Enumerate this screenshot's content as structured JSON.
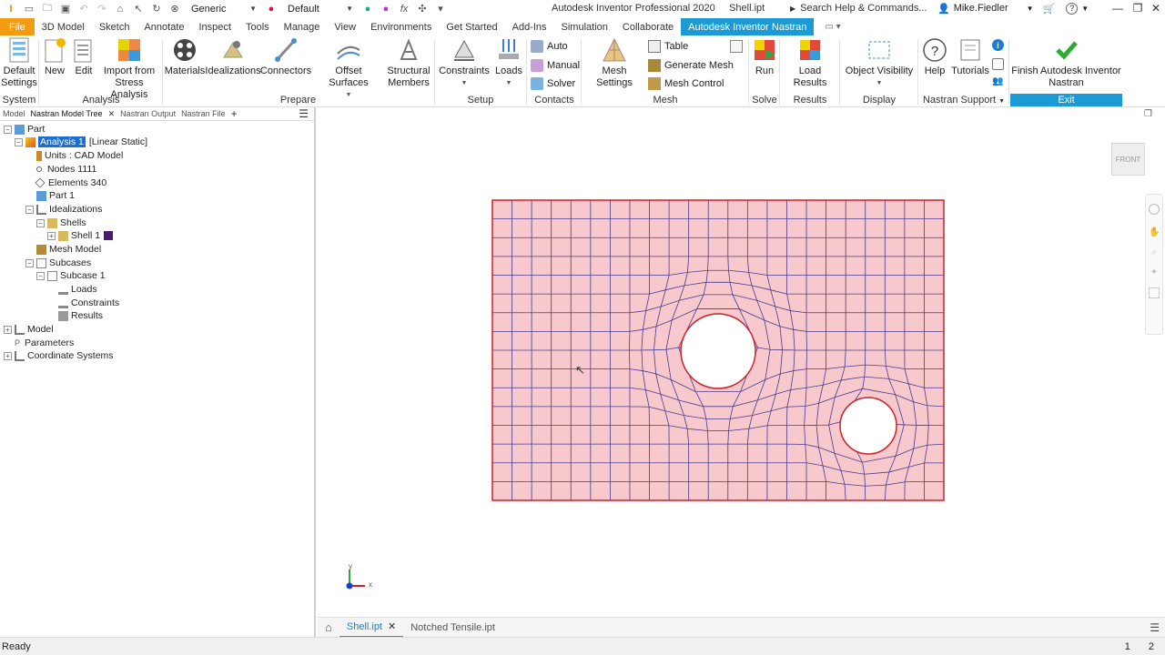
{
  "titlebar": {
    "app_title": "Autodesk Inventor Professional 2020",
    "doc_title": "Shell.ipt",
    "material_select": "Generic",
    "appearance_select": "Default",
    "search_placeholder": "Search Help & Commands...",
    "user_name": "Mike.Fiedler"
  },
  "ribbon_tabs": [
    "File",
    "3D Model",
    "Sketch",
    "Annotate",
    "Inspect",
    "Tools",
    "Manage",
    "View",
    "Environments",
    "Get Started",
    "Add-Ins",
    "Simulation",
    "Collaborate",
    "Autodesk Inventor Nastran"
  ],
  "ribbon": {
    "default_settings": "Default Settings",
    "new": "New",
    "edit": "Edit",
    "import_from_stress": "Import from Stress Analysis",
    "materials": "Materials",
    "idealizations": "Idealizations",
    "connectors": "Connectors",
    "offset_surfaces": "Offset Surfaces",
    "structural_members": "Structural Members",
    "constraints": "Constraints",
    "loads": "Loads",
    "auto": "Auto",
    "manual": "Manual",
    "solver": "Solver",
    "mesh_settings": "Mesh Settings",
    "table": "Table",
    "generate_mesh": "Generate Mesh",
    "mesh_control": "Mesh Control",
    "run": "Run",
    "load_results": "Load Results",
    "object_visibility": "Object Visibility",
    "help": "Help",
    "tutorials": "Tutorials",
    "finish": "Finish Autodesk Inventor Nastran",
    "groups": {
      "system": "System",
      "analysis": "Analysis",
      "prepare": "Prepare",
      "setup": "Setup",
      "contacts": "Contacts",
      "mesh": "Mesh",
      "solve": "Solve",
      "results": "Results",
      "display": "Display",
      "nastran_support": "Nastran Support",
      "exit": "Exit"
    }
  },
  "browser": {
    "tabs": [
      "Model",
      "Nastran Model Tree",
      "Nastran Output",
      "Nastran File"
    ],
    "tree": [
      {
        "label": "Part",
        "indent": 0
      },
      {
        "label": "Analysis 1",
        "suffix": "[Linear Static]",
        "indent": 1
      },
      {
        "label": "Units : CAD Model",
        "indent": 2
      },
      {
        "label": "Nodes 1111",
        "indent": 2
      },
      {
        "label": "Elements 340",
        "indent": 2
      },
      {
        "label": "Part 1",
        "indent": 2
      },
      {
        "label": "Idealizations",
        "indent": 2
      },
      {
        "label": "Shells",
        "indent": 3
      },
      {
        "label": "Shell 1",
        "indent": 4
      },
      {
        "label": "Mesh Model",
        "indent": 2
      },
      {
        "label": "Subcases",
        "indent": 2
      },
      {
        "label": "Subcase 1",
        "indent": 3
      },
      {
        "label": "Loads",
        "indent": 4
      },
      {
        "label": "Constraints",
        "indent": 4
      },
      {
        "label": "Results",
        "indent": 4
      },
      {
        "label": "Model",
        "indent": 0
      },
      {
        "label": "Parameters",
        "indent": 0
      },
      {
        "label": "Coordinate Systems",
        "indent": 0
      }
    ]
  },
  "viewport": {
    "viewcube_label": "FRONT",
    "axis_x": "x",
    "axis_y": "y",
    "mesh_fill": "#f7c9cc",
    "mesh_line": "#4a3b8f",
    "boundary": "#d0202a"
  },
  "doc_tabs": [
    "Shell.ipt",
    "Notched Tensile.ipt"
  ],
  "status": {
    "text": "Ready",
    "count1": "1",
    "count2": "2"
  }
}
